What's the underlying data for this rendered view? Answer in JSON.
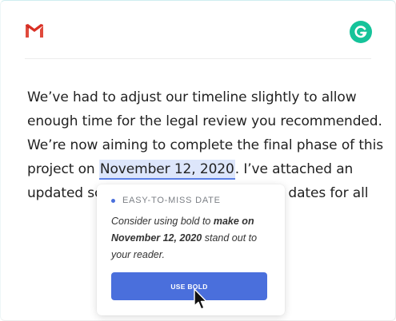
{
  "app": {
    "logo_icon": "gmail-logo-icon",
    "assistant_icon": "grammarly-logo-icon",
    "assistant_color": "#15c39a"
  },
  "email": {
    "line1": "We’ve had to adjust our timeline slightly to allow",
    "line2": "enough time for the legal review you recommended.",
    "line3": "We’re now aiming to complete the final phase of this",
    "line4_before": "project on ",
    "line4_highlight": "November 12, 2020",
    "line4_after": ". I’ve attached an",
    "line5_left": "updated sc",
    "line5_right": "w dates for all"
  },
  "suggestion": {
    "category": "EASY-TO-MISS DATE",
    "msg_prefix": "Consider using bold to ",
    "msg_bold": "make on November 12, 2020",
    "msg_suffix": " stand out to your reader.",
    "button_label": "USE BOLD",
    "accent": "#4a6fdc"
  }
}
